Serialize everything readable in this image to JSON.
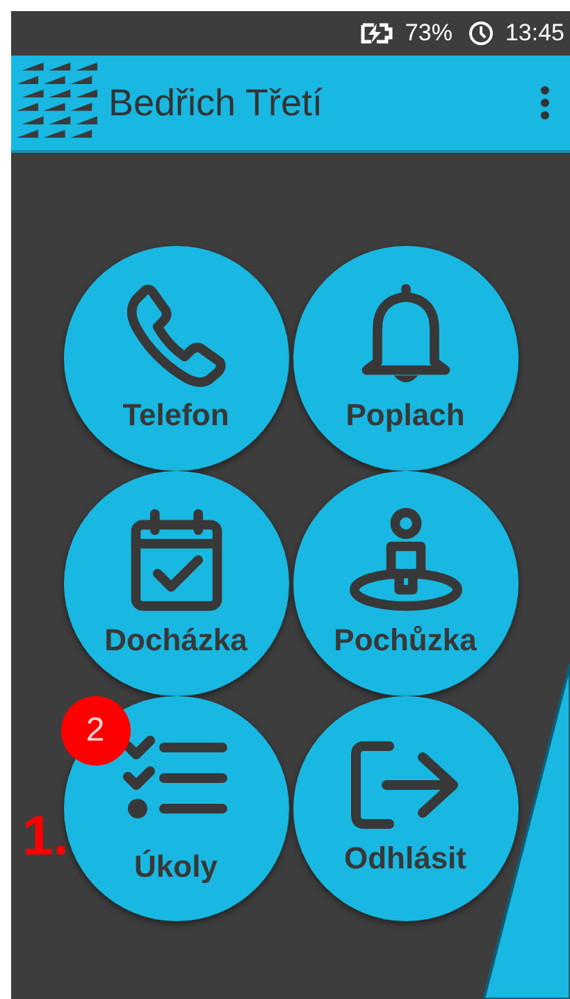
{
  "status_bar": {
    "battery": "73%",
    "time": "13:45"
  },
  "app_bar": {
    "title": "Bedřich Třetí"
  },
  "tiles": [
    {
      "kind": "phone",
      "label": "Telefon"
    },
    {
      "kind": "alarm",
      "label": "Poplach"
    },
    {
      "kind": "attendance",
      "label": "Docházka"
    },
    {
      "kind": "patrol",
      "label": "Pochůzka"
    },
    {
      "kind": "tasks",
      "label": "Úkoly",
      "badge": "2"
    },
    {
      "kind": "logout",
      "label": "Odhlásit"
    }
  ],
  "annotation": "1."
}
